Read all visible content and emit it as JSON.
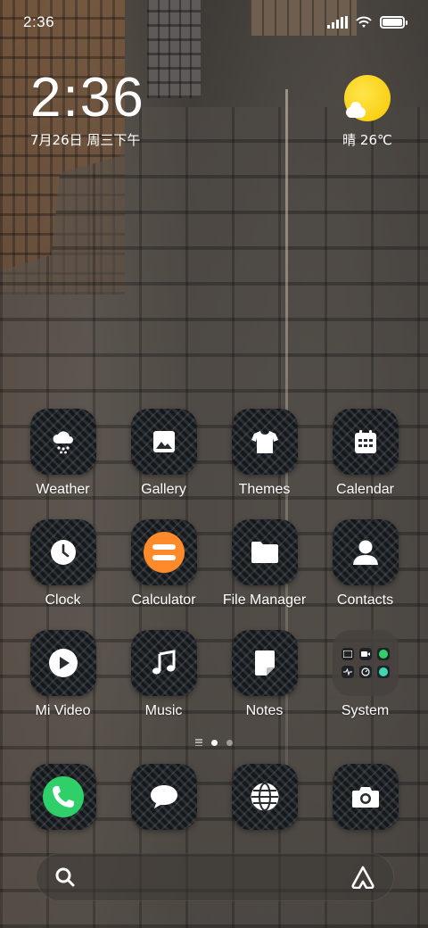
{
  "status_bar": {
    "time": "2:36"
  },
  "clock_widget": {
    "time": "2:36",
    "date": "7月26日 周三下午"
  },
  "weather_widget": {
    "text": "晴 26℃"
  },
  "apps": [
    {
      "label": "Weather",
      "icon": "cloud-snow-icon"
    },
    {
      "label": "Gallery",
      "icon": "image-icon"
    },
    {
      "label": "Themes",
      "icon": "tshirt-icon"
    },
    {
      "label": "Calendar",
      "icon": "calendar-icon"
    },
    {
      "label": "Clock",
      "icon": "clock-icon"
    },
    {
      "label": "Calculator",
      "icon": "equals-icon"
    },
    {
      "label": "File Manager",
      "icon": "folder-icon"
    },
    {
      "label": "Contacts",
      "icon": "person-icon"
    },
    {
      "label": "Mi Video",
      "icon": "play-icon"
    },
    {
      "label": "Music",
      "icon": "music-note-icon"
    },
    {
      "label": "Notes",
      "icon": "note-icon"
    },
    {
      "label": "System",
      "icon": "folder-group-icon"
    }
  ],
  "dock": [
    {
      "icon": "phone-icon"
    },
    {
      "icon": "message-icon"
    },
    {
      "icon": "globe-icon"
    },
    {
      "icon": "camera-icon"
    }
  ],
  "pages": {
    "current": 1,
    "total": 2
  },
  "search": {
    "icon_left": "search-icon",
    "icon_right": "assistant-icon"
  },
  "colors": {
    "sun": "#f7c800",
    "calculator": "#ff8a2a",
    "phone": "#2fd06a"
  }
}
